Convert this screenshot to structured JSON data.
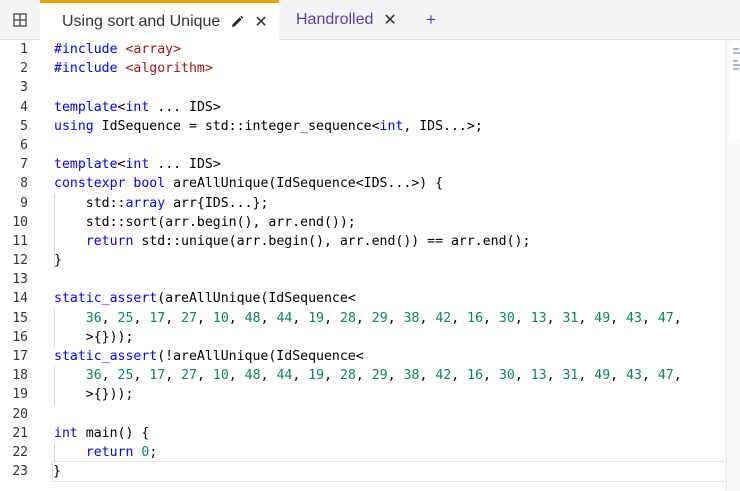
{
  "tabs": {
    "active_label": "Using sort and Unique",
    "inactive_label": "Handrolled",
    "close_glyph": "✕",
    "add_glyph": "+"
  },
  "line_numbers": [
    "1",
    "2",
    "3",
    "4",
    "5",
    "6",
    "7",
    "8",
    "9",
    "10",
    "11",
    "12",
    "13",
    "14",
    "15",
    "16",
    "17",
    "18",
    "19",
    "20",
    "21",
    "22",
    "23"
  ],
  "code_lines": [
    [
      {
        "t": "#include ",
        "c": "kw"
      },
      {
        "t": "<array>",
        "c": "str"
      }
    ],
    [
      {
        "t": "#include ",
        "c": "kw"
      },
      {
        "t": "<algorithm>",
        "c": "str"
      }
    ],
    [],
    [
      {
        "t": "template",
        "c": "kw"
      },
      {
        "t": "<",
        "c": ""
      },
      {
        "t": "int",
        "c": "kw"
      },
      {
        "t": " ... IDS>",
        "c": ""
      }
    ],
    [
      {
        "t": "using",
        "c": "kw"
      },
      {
        "t": " IdSequence = std::integer_sequence<",
        "c": ""
      },
      {
        "t": "int",
        "c": "kw"
      },
      {
        "t": ", IDS...>;",
        "c": ""
      }
    ],
    [],
    [
      {
        "t": "template",
        "c": "kw"
      },
      {
        "t": "<",
        "c": ""
      },
      {
        "t": "int",
        "c": "kw"
      },
      {
        "t": " ... IDS>",
        "c": ""
      }
    ],
    [
      {
        "t": "constexpr",
        "c": "kw"
      },
      {
        "t": " ",
        "c": ""
      },
      {
        "t": "bool",
        "c": "kw"
      },
      {
        "t": " areAllUnique(IdSequence<IDS...>) {",
        "c": ""
      }
    ],
    [
      {
        "t": "    std::",
        "c": ""
      },
      {
        "t": "array",
        "c": "kw"
      },
      {
        "t": " arr{IDS...};",
        "c": ""
      }
    ],
    [
      {
        "t": "    std::sort(arr.begin(), arr.end());",
        "c": ""
      }
    ],
    [
      {
        "t": "    ",
        "c": ""
      },
      {
        "t": "return",
        "c": "kw"
      },
      {
        "t": " std::unique(arr.begin(), arr.end()) == arr.end();",
        "c": ""
      }
    ],
    [
      {
        "t": "}",
        "c": ""
      }
    ],
    [],
    [
      {
        "t": "static_assert",
        "c": "kw"
      },
      {
        "t": "(areAllUnique(IdSequence<",
        "c": ""
      }
    ],
    [
      {
        "t": "    ",
        "c": ""
      },
      {
        "t": "36",
        "c": "num"
      },
      {
        "t": ", ",
        "c": ""
      },
      {
        "t": "25",
        "c": "num"
      },
      {
        "t": ", ",
        "c": ""
      },
      {
        "t": "17",
        "c": "num"
      },
      {
        "t": ", ",
        "c": ""
      },
      {
        "t": "27",
        "c": "num"
      },
      {
        "t": ", ",
        "c": ""
      },
      {
        "t": "10",
        "c": "num"
      },
      {
        "t": ", ",
        "c": ""
      },
      {
        "t": "48",
        "c": "num"
      },
      {
        "t": ", ",
        "c": ""
      },
      {
        "t": "44",
        "c": "num"
      },
      {
        "t": ", ",
        "c": ""
      },
      {
        "t": "19",
        "c": "num"
      },
      {
        "t": ", ",
        "c": ""
      },
      {
        "t": "28",
        "c": "num"
      },
      {
        "t": ", ",
        "c": ""
      },
      {
        "t": "29",
        "c": "num"
      },
      {
        "t": ", ",
        "c": ""
      },
      {
        "t": "38",
        "c": "num"
      },
      {
        "t": ", ",
        "c": ""
      },
      {
        "t": "42",
        "c": "num"
      },
      {
        "t": ", ",
        "c": ""
      },
      {
        "t": "16",
        "c": "num"
      },
      {
        "t": ", ",
        "c": ""
      },
      {
        "t": "30",
        "c": "num"
      },
      {
        "t": ", ",
        "c": ""
      },
      {
        "t": "13",
        "c": "num"
      },
      {
        "t": ", ",
        "c": ""
      },
      {
        "t": "31",
        "c": "num"
      },
      {
        "t": ", ",
        "c": ""
      },
      {
        "t": "49",
        "c": "num"
      },
      {
        "t": ", ",
        "c": ""
      },
      {
        "t": "43",
        "c": "num"
      },
      {
        "t": ", ",
        "c": ""
      },
      {
        "t": "47",
        "c": "num"
      },
      {
        "t": ",",
        "c": ""
      }
    ],
    [
      {
        "t": "    >{}));",
        "c": ""
      }
    ],
    [
      {
        "t": "static_assert",
        "c": "kw"
      },
      {
        "t": "(!areAllUnique(IdSequence<",
        "c": ""
      }
    ],
    [
      {
        "t": "    ",
        "c": ""
      },
      {
        "t": "36",
        "c": "num"
      },
      {
        "t": ", ",
        "c": ""
      },
      {
        "t": "25",
        "c": "num"
      },
      {
        "t": ", ",
        "c": ""
      },
      {
        "t": "17",
        "c": "num"
      },
      {
        "t": ", ",
        "c": ""
      },
      {
        "t": "27",
        "c": "num"
      },
      {
        "t": ", ",
        "c": ""
      },
      {
        "t": "10",
        "c": "num"
      },
      {
        "t": ", ",
        "c": ""
      },
      {
        "t": "48",
        "c": "num"
      },
      {
        "t": ", ",
        "c": ""
      },
      {
        "t": "44",
        "c": "num"
      },
      {
        "t": ", ",
        "c": ""
      },
      {
        "t": "19",
        "c": "num"
      },
      {
        "t": ", ",
        "c": ""
      },
      {
        "t": "28",
        "c": "num"
      },
      {
        "t": ", ",
        "c": ""
      },
      {
        "t": "29",
        "c": "num"
      },
      {
        "t": ", ",
        "c": ""
      },
      {
        "t": "38",
        "c": "num"
      },
      {
        "t": ", ",
        "c": ""
      },
      {
        "t": "42",
        "c": "num"
      },
      {
        "t": ", ",
        "c": ""
      },
      {
        "t": "16",
        "c": "num"
      },
      {
        "t": ", ",
        "c": ""
      },
      {
        "t": "30",
        "c": "num"
      },
      {
        "t": ", ",
        "c": ""
      },
      {
        "t": "13",
        "c": "num"
      },
      {
        "t": ", ",
        "c": ""
      },
      {
        "t": "31",
        "c": "num"
      },
      {
        "t": ", ",
        "c": ""
      },
      {
        "t": "49",
        "c": "num"
      },
      {
        "t": ", ",
        "c": ""
      },
      {
        "t": "43",
        "c": "num"
      },
      {
        "t": ", ",
        "c": ""
      },
      {
        "t": "47",
        "c": "num"
      },
      {
        "t": ",",
        "c": ""
      }
    ],
    [
      {
        "t": "    >{}));",
        "c": ""
      }
    ],
    [],
    [
      {
        "t": "int",
        "c": "kw"
      },
      {
        "t": " main() {",
        "c": ""
      }
    ],
    [
      {
        "t": "    ",
        "c": ""
      },
      {
        "t": "return",
        "c": "kw"
      },
      {
        "t": " ",
        "c": ""
      },
      {
        "t": "0",
        "c": "num"
      },
      {
        "t": ";",
        "c": ""
      }
    ],
    [
      {
        "t": "}",
        "c": ""
      }
    ]
  ],
  "colors": {
    "keyword": "#0000ff",
    "string": "#a31515",
    "number": "#098658",
    "active_tab_accent": "#f0a000",
    "inactive_tab_text": "#5a3fb0"
  },
  "icons": {
    "layout": "layout-grid-icon",
    "edit": "pencil-icon",
    "close": "close-icon",
    "add": "plus-icon"
  }
}
